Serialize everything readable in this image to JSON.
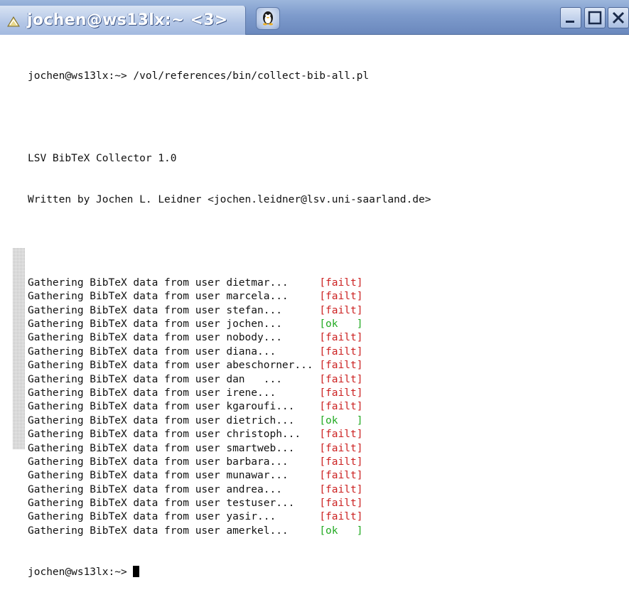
{
  "window": {
    "title": "jochen@ws13lx:~ <3>",
    "buttons": {
      "minimize": "minimize",
      "maximize": "maximize",
      "close": "close"
    }
  },
  "terminal": {
    "command_line": "jochen@ws13lx:~> /vol/references/bin/collect-bib-all.pl",
    "banner": [
      "LSV BibTeX Collector 1.0",
      "Written by Jochen L. Leidner <jochen.leidner@lsv.uni-saarland.de>"
    ],
    "gather_rows": [
      {
        "text": "Gathering BibTeX data from user dietmar...     ",
        "lb": "[",
        "status": "failt",
        "rb": "]",
        "state": "fail"
      },
      {
        "text": "Gathering BibTeX data from user marcela...     ",
        "lb": "[",
        "status": "failt",
        "rb": "]",
        "state": "fail"
      },
      {
        "text": "Gathering BibTeX data from user stefan...      ",
        "lb": "[",
        "status": "failt",
        "rb": "]",
        "state": "fail"
      },
      {
        "text": "Gathering BibTeX data from user jochen...      ",
        "lb": "[",
        "status": "ok   ",
        "rb": "]",
        "state": "ok"
      },
      {
        "text": "Gathering BibTeX data from user nobody...      ",
        "lb": "[",
        "status": "failt",
        "rb": "]",
        "state": "fail"
      },
      {
        "text": "Gathering BibTeX data from user diana...       ",
        "lb": "[",
        "status": "failt",
        "rb": "]",
        "state": "fail"
      },
      {
        "text": "Gathering BibTeX data from user abeschorner... ",
        "lb": "[",
        "status": "failt",
        "rb": "]",
        "state": "fail"
      },
      {
        "text": "Gathering BibTeX data from user dan   ...      ",
        "lb": "[",
        "status": "failt",
        "rb": "]",
        "state": "fail"
      },
      {
        "text": "Gathering BibTeX data from user irene...       ",
        "lb": "[",
        "status": "failt",
        "rb": "]",
        "state": "fail"
      },
      {
        "text": "Gathering BibTeX data from user kgaroufi...    ",
        "lb": "[",
        "status": "failt",
        "rb": "]",
        "state": "fail"
      },
      {
        "text": "Gathering BibTeX data from user dietrich...    ",
        "lb": "[",
        "status": "ok   ",
        "rb": "]",
        "state": "ok"
      },
      {
        "text": "Gathering BibTeX data from user christoph...   ",
        "lb": "[",
        "status": "failt",
        "rb": "]",
        "state": "fail"
      },
      {
        "text": "Gathering BibTeX data from user smartweb...    ",
        "lb": "[",
        "status": "failt",
        "rb": "]",
        "state": "fail"
      },
      {
        "text": "Gathering BibTeX data from user barbara...     ",
        "lb": "[",
        "status": "failt",
        "rb": "]",
        "state": "fail"
      },
      {
        "text": "Gathering BibTeX data from user munawar...     ",
        "lb": "[",
        "status": "failt",
        "rb": "]",
        "state": "fail"
      },
      {
        "text": "Gathering BibTeX data from user andrea...      ",
        "lb": "[",
        "status": "failt",
        "rb": "]",
        "state": "fail"
      },
      {
        "text": "Gathering BibTeX data from user testuser...    ",
        "lb": "[",
        "status": "failt",
        "rb": "]",
        "state": "fail"
      },
      {
        "text": "Gathering BibTeX data from user yasir...       ",
        "lb": "[",
        "status": "failt",
        "rb": "]",
        "state": "fail"
      },
      {
        "text": "Gathering BibTeX data from user amerkel...     ",
        "lb": "[",
        "status": "ok   ",
        "rb": "]",
        "state": "ok"
      }
    ],
    "prompt": "jochen@ws13lx:~> "
  },
  "colors": {
    "ok": "#22aa22",
    "fail": "#cc2222",
    "titlebar": "#7e9bcc"
  }
}
